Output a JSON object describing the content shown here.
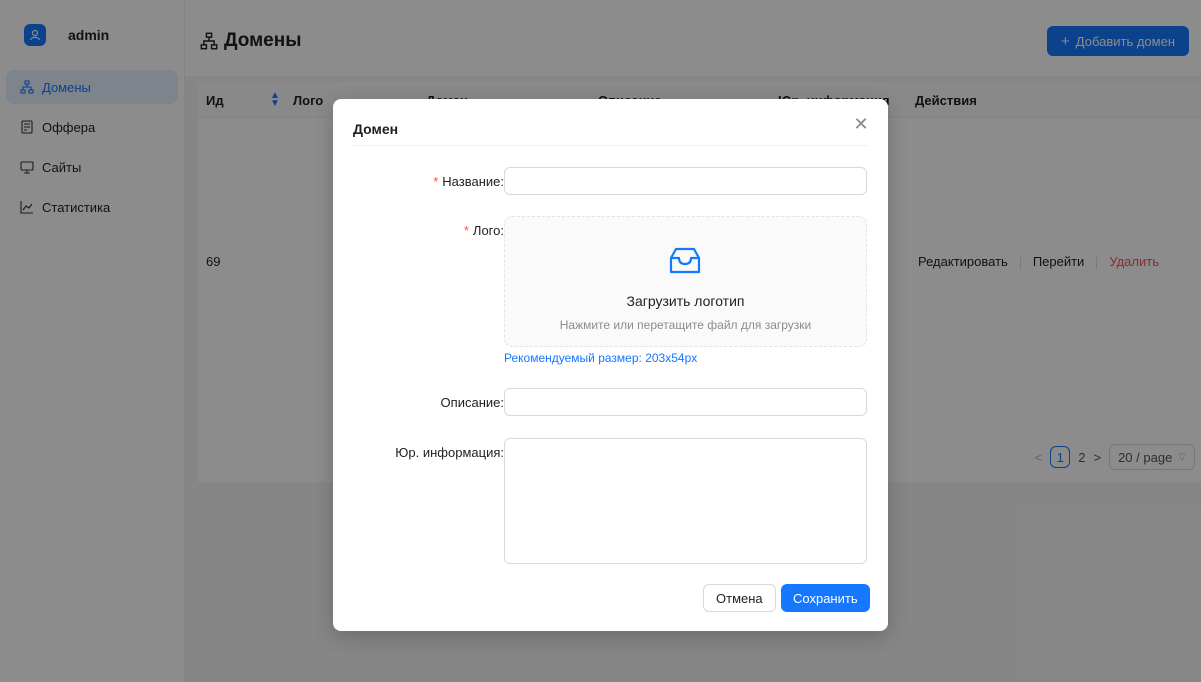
{
  "sidebar": {
    "user_name": "admin",
    "items": [
      {
        "label": "Домены",
        "icon": "sitemap-icon",
        "active": true
      },
      {
        "label": "Оффера",
        "icon": "file-icon",
        "active": false
      },
      {
        "label": "Сайты",
        "icon": "monitor-icon",
        "active": false
      },
      {
        "label": "Статистика",
        "icon": "line-chart-icon",
        "active": false
      }
    ]
  },
  "header": {
    "title": "Домены",
    "add_button": "Добавить домен",
    "add_icon": "+"
  },
  "table": {
    "columns": [
      "Ид",
      "Лого",
      "Домен",
      "Описание",
      "Юр. информация",
      "Действия"
    ],
    "rows": [
      {
        "id": "69",
        "actions": [
          "Редактировать",
          "Перейти",
          "Удалить"
        ]
      }
    ],
    "pagination": {
      "prev": "<",
      "current": "1",
      "next_page": "2",
      "next": ">",
      "page_size": "20 / page"
    }
  },
  "modal": {
    "title": "Домен",
    "close_icon": "✕",
    "fields": {
      "name_label": "Название",
      "logo_label": "Лого",
      "description_label": "Описание",
      "legal_label": "Юр. информация",
      "label_colon": ":"
    },
    "upload": {
      "title": "Загрузить логотип",
      "hint": "Нажмите или перетащите файл для загрузки",
      "recommended": "Рекомендуемый размер: 203x54px"
    },
    "cancel_button": "Отмена",
    "save_button": "Сохранить"
  },
  "colors": {
    "primary": "#1677ff",
    "danger": "#ff4d4f",
    "required": "#ff4d4f"
  }
}
